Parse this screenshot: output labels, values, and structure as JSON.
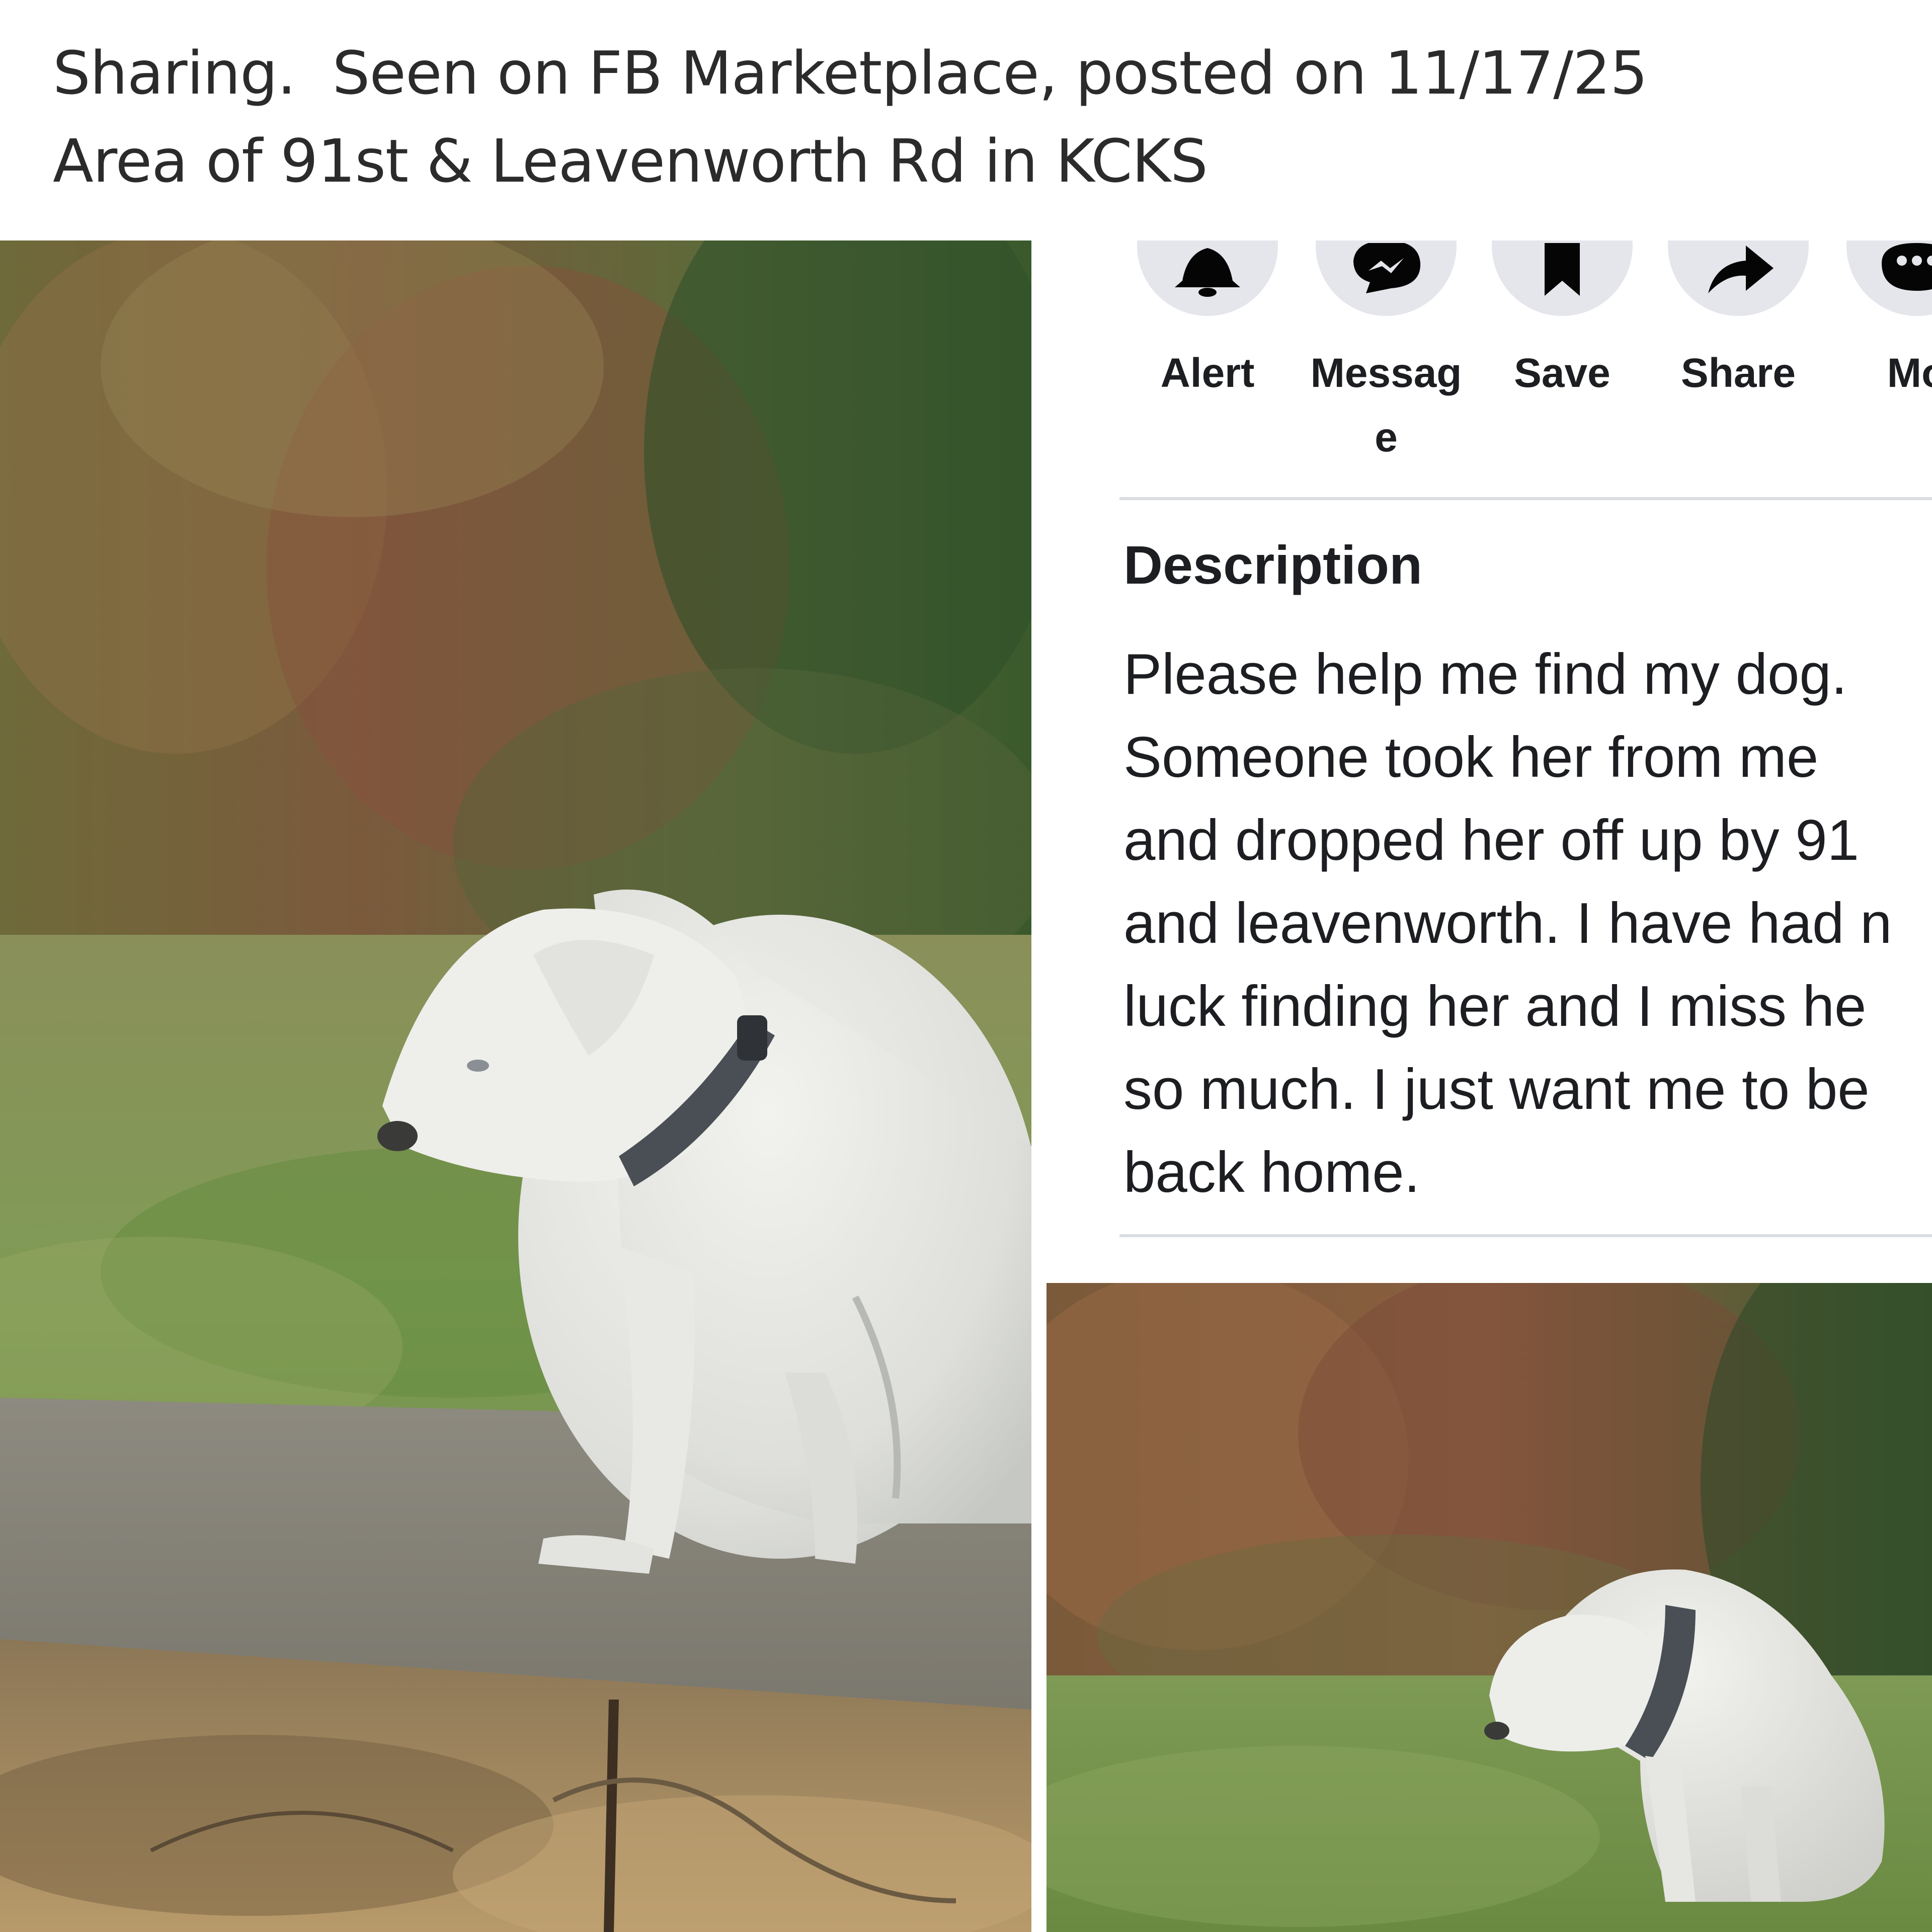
{
  "caption": {
    "line1": "Sharing.  Seen on FB Marketplace, posted on 11/17/25",
    "line2": "Area of 91st & Leavenworth Rd in KCKS"
  },
  "actions": [
    {
      "label": "Alert",
      "icon": "bell-icon"
    },
    {
      "label": "Messag e",
      "icon": "messenger-icon"
    },
    {
      "label": "Save",
      "icon": "bookmark-icon"
    },
    {
      "label": "Share",
      "icon": "share-arrow-icon"
    },
    {
      "label": "Mo",
      "icon": "more-icon"
    }
  ],
  "description": {
    "heading": "Description",
    "lines": [
      "Please help me find my dog.",
      "Someone took her from me",
      "and dropped her off up by 91",
      "and leavenworth. I have had n",
      "luck finding her and I miss he",
      "so much. I just want me to be",
      "back home."
    ]
  },
  "photos": {
    "main": "white-dog-sitting-by-roadside-photo",
    "secondary": "white-dog-in-grass-photo"
  },
  "colors": {
    "icon_circle": "#e4e6eb",
    "icon_glyph": "#050505",
    "text": "#1c1e21",
    "divider": "#dadde1",
    "caption_text": "#2b2b2b"
  }
}
